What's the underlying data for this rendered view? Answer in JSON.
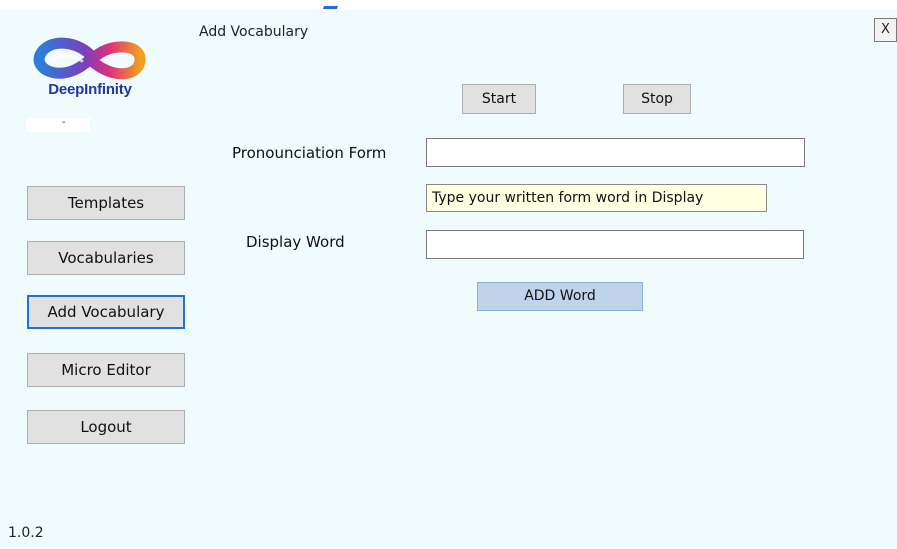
{
  "window": {
    "title": "Add Vocabulary",
    "close_label": "X"
  },
  "logo": {
    "text": "DeepInfinity",
    "sub": "-"
  },
  "sidebar": {
    "items": [
      {
        "label": "Templates"
      },
      {
        "label": "Vocabularies"
      },
      {
        "label": "Add Vocabulary",
        "active": true
      },
      {
        "label": "Micro Editor"
      },
      {
        "label": "Logout"
      }
    ],
    "version": "1.0.2"
  },
  "recorder": {
    "start_label": "Start",
    "stop_label": "Stop"
  },
  "form": {
    "pronunciation_label": "Pronounciation Form",
    "pronunciation_value": "",
    "hint": "Type your written form word in Display",
    "display_label": "Display Word",
    "display_value": "",
    "add_label": "ADD Word"
  },
  "colors": {
    "background": "#f0fbfd",
    "brand": "#23369e",
    "active_border": "#1e74d6",
    "hint_bg": "#ffffe1",
    "add_button": "#bfd3ea"
  }
}
